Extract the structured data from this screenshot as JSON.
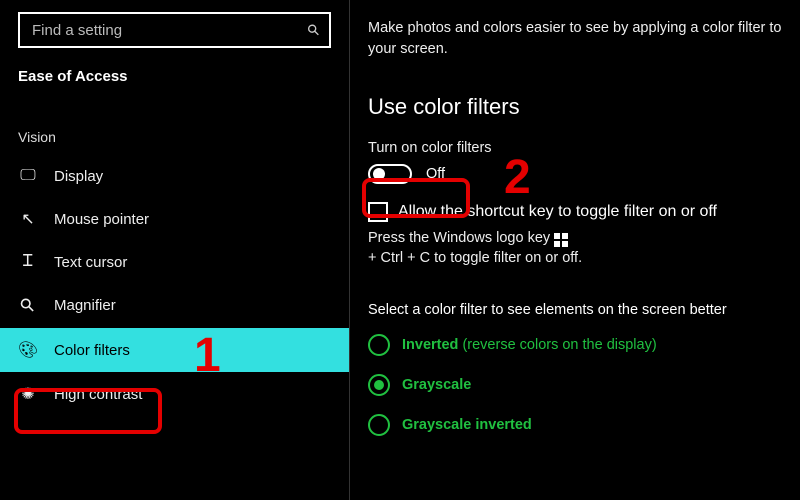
{
  "search": {
    "placeholder": "Find a setting"
  },
  "section": "Ease of Access",
  "group": "Vision",
  "nav": [
    {
      "label": "Display"
    },
    {
      "label": "Mouse pointer"
    },
    {
      "label": "Text cursor"
    },
    {
      "label": "Magnifier"
    },
    {
      "label": "Color filters"
    },
    {
      "label": "High contrast"
    }
  ],
  "main": {
    "intro": "Make photos and colors easier to see by applying a color filter to your screen.",
    "heading": "Use color filters",
    "toggle_label": "Turn on color filters",
    "toggle_state": "Off",
    "checkbox_label": "Allow the shortcut key to toggle filter on or off",
    "hint_prefix": "Press the Windows logo key",
    "hint_suffix": "+ Ctrl + C to toggle filter on or off.",
    "select_label": "Select a color filter to see elements on the screen better",
    "options": [
      {
        "label": "Inverted",
        "extra": "(reverse colors on the display)",
        "checked": false
      },
      {
        "label": "Grayscale",
        "extra": "",
        "checked": true
      },
      {
        "label": "Grayscale inverted",
        "extra": "",
        "checked": false
      }
    ]
  },
  "annotations": {
    "num1": "1",
    "num2": "2"
  }
}
